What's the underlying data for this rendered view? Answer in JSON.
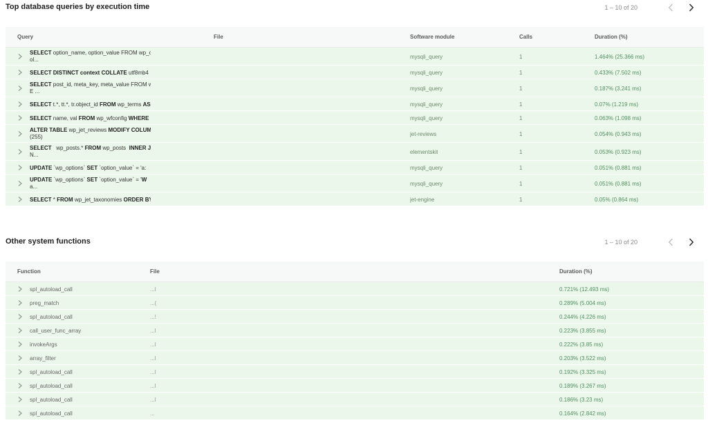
{
  "queries": {
    "title": "Top database queries by execution time",
    "pagination": "1 – 10 of 20",
    "columns": {
      "query": "Query",
      "file": "File",
      "module": "Software module",
      "calls": "Calls",
      "duration": "Duration (%)"
    },
    "rows": [
      {
        "line1": [
          {
            "k": "SELECT",
            "b": true
          },
          {
            "k": " option_name, option_value FROM wp_o",
            "b": false
          }
        ],
        "line2": "ol...",
        "module": "mysqli_query",
        "calls": "1",
        "duration": "1.464% (25.366 ms)"
      },
      {
        "line1": [
          {
            "k": "SELECT DISTINCT context COLLATE",
            "b": true
          },
          {
            "k": " utf8mb4",
            "b": false
          }
        ],
        "line2": "",
        "module": "mysqli_query",
        "calls": "1",
        "duration": "0.433% (7.502 ms)"
      },
      {
        "line1": [
          {
            "k": "SELECT",
            "b": true
          },
          {
            "k": " post_id, meta_key, meta_value FROM wp",
            "b": false
          }
        ],
        "line2": "E ...",
        "module": "mysqli_query",
        "calls": "1",
        "duration": "0.187% (3.241 ms)"
      },
      {
        "line1": [
          {
            "k": "SELECT",
            "b": true
          },
          {
            "k": " t.*, tt.*, tr.object_id ",
            "b": false
          },
          {
            "k": "FROM",
            "b": true
          },
          {
            "k": " wp_terms ",
            "b": false
          },
          {
            "k": "AS",
            "b": true
          }
        ],
        "line2": "",
        "module": "mysqli_query",
        "calls": "1",
        "duration": "0.07% (1.219 ms)"
      },
      {
        "line1": [
          {
            "k": "SELECT",
            "b": true
          },
          {
            "k": " name, val ",
            "b": false
          },
          {
            "k": "FROM",
            "b": true
          },
          {
            "k": " wp_wfconfig ",
            "b": false
          },
          {
            "k": "WHERE",
            "b": true
          },
          {
            "k": " a",
            "b": false
          }
        ],
        "line2": "",
        "module": "mysqli_query",
        "calls": "1",
        "duration": "0.063% (1.098 ms)"
      },
      {
        "line1": [
          {
            "k": "ALTER TABLE",
            "b": true
          },
          {
            "k": " wp_jet_reviews ",
            "b": false
          },
          {
            "k": "MODIFY COLUMN",
            "b": true
          }
        ],
        "line2": "(255)",
        "module": "jet-reviews",
        "calls": "1",
        "duration": "0.054% (0.943 ms)"
      },
      {
        "line1": [
          {
            "k": "SELECT",
            "b": true
          },
          {
            "k": "   wp_posts.* ",
            "b": false
          },
          {
            "k": "FROM",
            "b": true
          },
          {
            "k": " wp_posts  ",
            "b": false
          },
          {
            "k": "INNER JO",
            "b": true
          }
        ],
        "line2": "N...",
        "module": "elementskit",
        "calls": "1",
        "duration": "0.053% (0.923 ms)"
      },
      {
        "line1": [
          {
            "k": "UPDATE",
            "b": true
          },
          {
            "k": " `wp_options` ",
            "b": false
          },
          {
            "k": "SET",
            "b": true
          },
          {
            "k": " `option_value` = 'a:",
            "b": false
          }
        ],
        "line2": "",
        "module": "mysqli_query",
        "calls": "1",
        "duration": "0.051% (0.881 ms)"
      },
      {
        "line1": [
          {
            "k": "UPDATE",
            "b": true
          },
          {
            "k": " `wp_options` ",
            "b": false
          },
          {
            "k": "SET",
            "b": true
          },
          {
            "k": " `option_value` = '",
            "b": false
          },
          {
            "k": "W",
            "b": true
          }
        ],
        "line2": "a...",
        "module": "mysqli_query",
        "calls": "1",
        "duration": "0.051% (0.881 ms)"
      },
      {
        "line1": [
          {
            "k": "SELECT",
            "b": true
          },
          {
            "k": " * ",
            "b": false
          },
          {
            "k": "FROM",
            "b": true
          },
          {
            "k": " wp_jet_taxonomies ",
            "b": false
          },
          {
            "k": "ORDER BY",
            "b": true
          }
        ],
        "line2": "",
        "module": "jet-engine",
        "calls": "1",
        "duration": "0.05% (0.864 ms)"
      }
    ]
  },
  "functions": {
    "title": "Other system functions",
    "pagination": "1 – 10 of 20",
    "columns": {
      "function": "Function",
      "file": "File",
      "duration": "Duration (%)"
    },
    "rows": [
      {
        "name": "spl_autoload_call",
        "file": "...l",
        "duration": "0.721% (12.493 ms)"
      },
      {
        "name": "preg_match",
        "file": "...(",
        "duration": "0.289% (5.004 ms)"
      },
      {
        "name": "spl_autoload_call",
        "file": "...!",
        "duration": "0.244% (4.226 ms)"
      },
      {
        "name": "call_user_func_array",
        "file": "...l",
        "duration": "0.223% (3.855 ms)"
      },
      {
        "name": "invokeArgs",
        "file": "...l",
        "duration": "0.222% (3.85 ms)"
      },
      {
        "name": "array_filter",
        "file": "...l",
        "duration": "0.203% (3.522 ms)"
      },
      {
        "name": "spl_autoload_call",
        "file": "...l",
        "duration": "0.192% (3.325 ms)"
      },
      {
        "name": "spl_autoload_call",
        "file": "...l",
        "duration": "0.189% (3.267 ms)"
      },
      {
        "name": "spl_autoload_call",
        "file": "...l",
        "duration": "0.186% (3.23 ms)"
      },
      {
        "name": "spl_autoload_call",
        "file": "...",
        "duration": "0.164% (2.842 ms)"
      }
    ]
  },
  "icons": {
    "prev": "chevron-left-icon",
    "next": "chevron-right-icon",
    "expand": "chevron-right-icon"
  },
  "colors": {
    "row_bg": "#ebf7ea",
    "header_bg": "#f7f8f8",
    "duration_text": "#4f8f5f"
  }
}
